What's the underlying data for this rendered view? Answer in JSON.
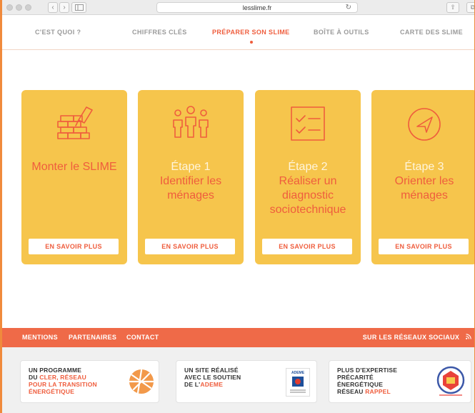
{
  "browser": {
    "url": "lesslime.fr",
    "back": "‹",
    "forward": "›",
    "reload": "↻",
    "share": "⇧",
    "tabs": "⧉"
  },
  "nav": {
    "items": [
      {
        "label": "C'EST QUOI ?"
      },
      {
        "label": "CHIFFRES CLÉS"
      },
      {
        "label": "PRÉPARER SON SLIME"
      },
      {
        "label": "BOÎTE À OUTILS"
      },
      {
        "label": "CARTE DES SLIME"
      }
    ],
    "active_index": 2
  },
  "cards": [
    {
      "icon": "brick-trowel-icon",
      "step": "",
      "title": "Monter le SLIME",
      "button": "EN SAVOIR PLUS"
    },
    {
      "icon": "people-icon",
      "step": "Étape 1",
      "title": "Identifier les ménages",
      "button": "EN SAVOIR PLUS"
    },
    {
      "icon": "checklist-icon",
      "step": "Étape 2",
      "title": "Réaliser un diagnostic sociotechnique",
      "button": "EN SAVOIR PLUS"
    },
    {
      "icon": "compass-arrow-icon",
      "step": "Étape 3",
      "title": "Orienter les ménages",
      "button": "EN SAVOIR PLUS"
    }
  ],
  "footer": {
    "links": [
      "MENTIONS",
      "PARTENAIRES",
      "CONTACT"
    ],
    "social": "SUR LES RÉSEAUX SOCIAUX",
    "partners": [
      {
        "lines": [
          "UN PROGRAMME",
          "DU "
        ],
        "hl1": "CLER, RÉSEAU",
        "hl2": "POUR LA TRANSITION",
        "hl3": "ÉNERGÉTIQUE"
      },
      {
        "lines": [
          "UN SITE RÉALISÉ",
          "AVEC LE SOUTIEN",
          "DE L'"
        ],
        "hl": "ADEME",
        "logo_caption": "ADEME"
      },
      {
        "lines": [
          "PLUS D'EXPERTISE",
          "PRÉCARITÉ",
          "ÉNERGÉTIQUE",
          "RÉSEAU "
        ],
        "hl": "RAPPEL"
      }
    ]
  },
  "colors": {
    "accent": "#ef5d3d",
    "card": "#f6c54c",
    "footer_bar": "#ef6a48"
  }
}
